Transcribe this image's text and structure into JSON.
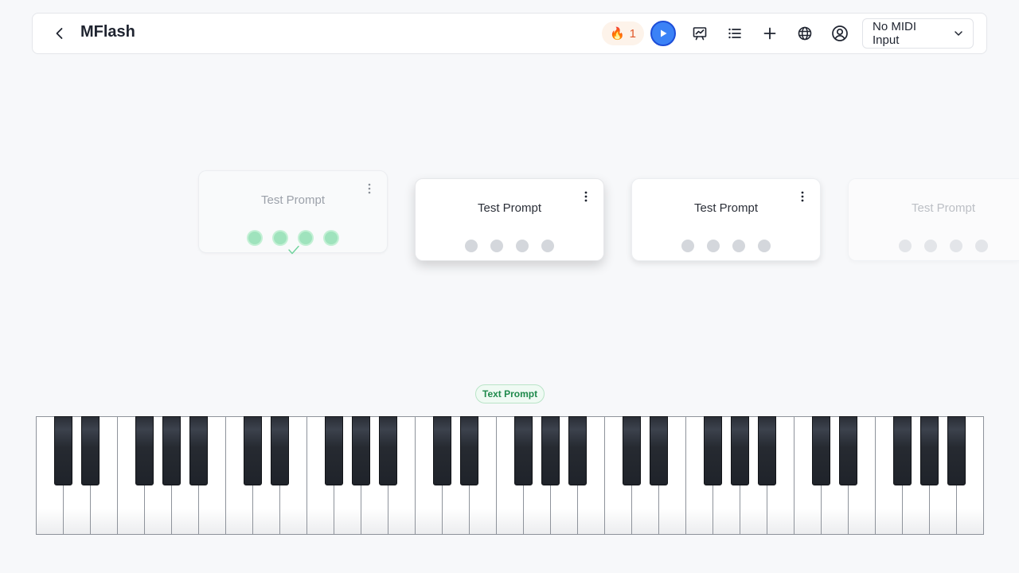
{
  "header": {
    "title": "MFlash",
    "streak_count": "1",
    "midi_select_label": "No MIDI Input"
  },
  "cards": [
    {
      "title": "Test Prompt",
      "state": "done"
    },
    {
      "title": "Test Prompt",
      "state": "active"
    },
    {
      "title": "Test Prompt",
      "state": "upcoming"
    },
    {
      "title": "Test Prompt",
      "state": "upcoming"
    }
  ],
  "keyboard": {
    "prompt_badge": "Text Prompt",
    "white_key_count": 35
  },
  "colors": {
    "accent": "#3b82f6",
    "success": "#1f8a4c",
    "streak": "#e0582a"
  },
  "icons": [
    "back-arrow-icon",
    "flame-icon",
    "play-icon",
    "chart-icon",
    "list-icon",
    "plus-icon",
    "globe-icon",
    "user-circle-icon",
    "chevron-down-icon",
    "kebab-menu-icon",
    "check-icon"
  ]
}
